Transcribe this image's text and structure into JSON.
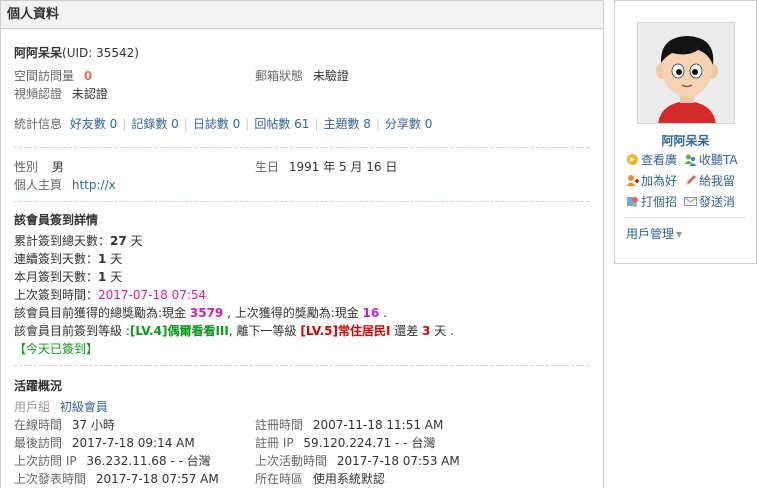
{
  "header": {
    "title": "個人資料"
  },
  "profile": {
    "name": "阿阿呆呆",
    "uid": "(UID: 35542)",
    "space_visits_label": "空間訪問量",
    "space_visits_value": "0",
    "email_status_label": "郵箱狀態",
    "email_status_value": "未驗證",
    "video_auth_label": "視頻認證",
    "video_auth_value": "未認證"
  },
  "stats": {
    "label": "統計信息",
    "items": [
      {
        "label": "好友數 0"
      },
      {
        "label": "記錄數 0"
      },
      {
        "label": "日誌數 0"
      },
      {
        "label": "回帖數 61"
      },
      {
        "label": "主題數 8"
      },
      {
        "label": "分享數 0"
      }
    ]
  },
  "personal": {
    "gender_label": "性別",
    "gender_value": "男",
    "birthday_label": "生日",
    "birthday_value": "1991 年 5 月 16 日",
    "homepage_label": "個人主頁",
    "homepage_value": "http://x"
  },
  "signin": {
    "title": "該會員簽到詳情",
    "total_label": "累計簽到總天數：",
    "total_value": "27",
    "total_unit": "天",
    "streak_label": "連續簽到天數：",
    "streak_value": "1",
    "streak_unit": "天",
    "month_label": "本月簽到天數：",
    "month_value": "1",
    "month_unit": "天",
    "last_label": "上次簽到時間：",
    "last_value": "2017-07-18 07:54",
    "reward_prefix": "該會員目前獲得的總獎勵為:現金",
    "reward_total": "3579",
    "reward_mid": ", 上次獲得的獎勵為:現金",
    "reward_last": "16",
    "reward_end": ".",
    "level_prefix": "該會員目前簽到等級 :",
    "level_current": "[LV.4]偶爾看看III",
    "level_mid": ", 離下一等級",
    "level_next": "[LV.5]常住居民I",
    "level_gap_label": "還差",
    "level_gap_value": "3",
    "level_gap_unit": "天 .",
    "today_status": "【今天已簽到】"
  },
  "activity": {
    "title": "活躍概況",
    "group_label": "用戶組",
    "group_value": "初級會員",
    "online_label": "在線時間",
    "online_value": "37 小時",
    "register_time_label": "註冊時間",
    "register_time_value": "2007-11-18 11:51 AM",
    "last_visit_label": "最後訪問",
    "last_visit_value": "2017-7-18 09:14 AM",
    "register_ip_label": "註冊 IP",
    "register_ip_value": "59.120.224.71 - - 台灣",
    "last_ip_label": "上次訪問 IP",
    "last_ip_value": "36.232.11.68 - - 台灣",
    "last_active_label": "上次活動時間",
    "last_active_value": "2017-7-18 07:53 AM",
    "last_post_label": "上次發表時間",
    "last_post_value": "2017-7-18 07:57 AM",
    "timezone_label": "所在時區",
    "timezone_value": "使用系統默認"
  },
  "sidebar": {
    "name": "阿阿呆呆",
    "actions": [
      {
        "label": "查看廣",
        "icon": "broadcast-icon"
      },
      {
        "label": "收聽TA",
        "icon": "follow-icon"
      },
      {
        "label": "加為好",
        "icon": "add-friend-icon"
      },
      {
        "label": "給我留",
        "icon": "message-icon"
      },
      {
        "label": "打個招",
        "icon": "greet-icon"
      },
      {
        "label": "發送消",
        "icon": "mail-icon"
      }
    ],
    "manage_label": "用戶管理"
  }
}
